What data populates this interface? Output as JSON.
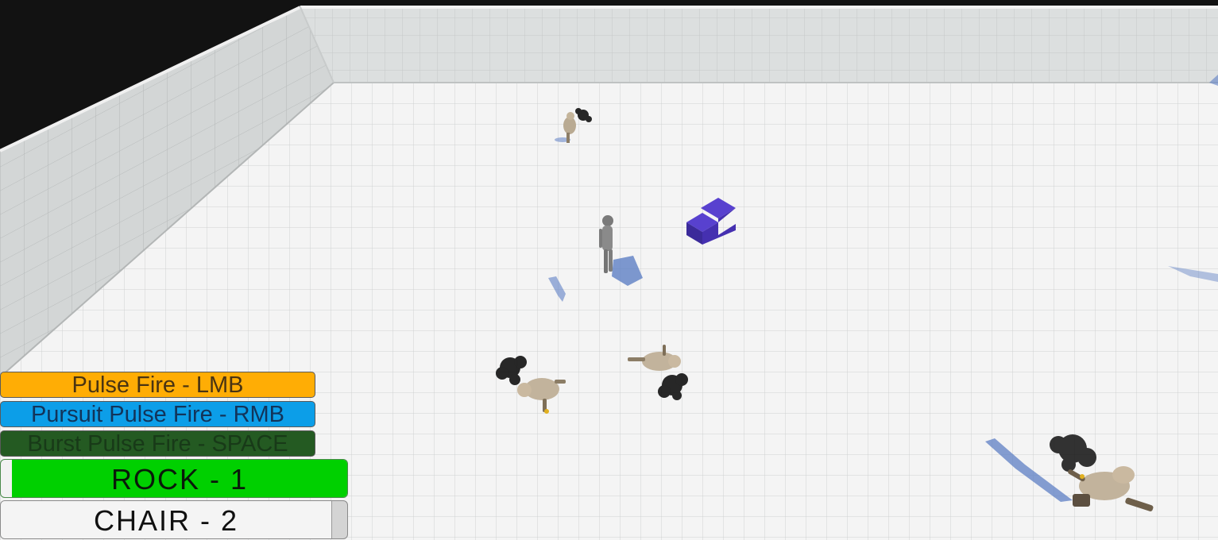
{
  "hud": {
    "controls": {
      "pulse_fire": "Pulse Fire - LMB",
      "pursuit_pulse_fire": "Pursuit Pulse Fire - RMB",
      "burst_pulse_fire": "Burst Pulse Fire - SPACE"
    },
    "inventory": {
      "rock": {
        "label": "ROCK - 1",
        "selected": true
      },
      "chair": {
        "label": "CHAIR - 2",
        "selected": false
      }
    }
  },
  "colors": {
    "pulse_fire": "#ffad05",
    "pursuit_pulse_fire": "#0c9ee8",
    "burst_pulse_fire": "#245a22",
    "rock_selected": "#00d000",
    "chair": "#f4f4f4",
    "floor": "#f4f4f4",
    "wall": "#d9dcdc",
    "grid": "#cfd2d2",
    "sky": "#121212",
    "stairs_block": "#4a33b8",
    "shadow": "#5e7fc4"
  },
  "scene": {
    "entities": [
      "player",
      "enemy",
      "stairs-block",
      "smoke-cloud"
    ]
  }
}
